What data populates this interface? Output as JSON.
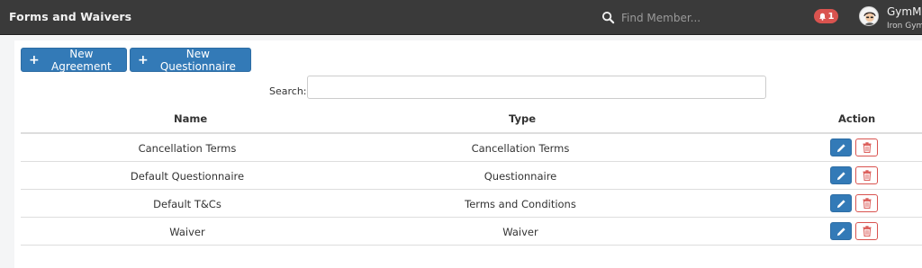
{
  "header": {
    "title": "Forms and Waivers",
    "search_placeholder": "Find Member...",
    "notification_count": "1",
    "user_name": "GymMas",
    "user_gym": "Iron Gym ..."
  },
  "toolbar": {
    "new_agreement_label": "New Agreement",
    "new_questionnaire_label": "New Questionnaire"
  },
  "table": {
    "search_label": "Search:",
    "columns": [
      "Name",
      "Type",
      "Action"
    ],
    "rows": [
      {
        "name": "Cancellation Terms",
        "type": "Cancellation Terms"
      },
      {
        "name": "Default Questionnaire",
        "type": "Questionnaire"
      },
      {
        "name": "Default T&Cs",
        "type": "Terms and Conditions"
      },
      {
        "name": "Waiver",
        "type": "Waiver"
      }
    ]
  },
  "colors": {
    "topbar": "#3a3a3a",
    "primary": "#337ab7",
    "danger": "#d9534f",
    "page_background": "#f4f5f6"
  },
  "icons": {
    "search": "search-icon",
    "bell": "bell-icon",
    "plus": "plus-icon",
    "edit": "pencil-icon",
    "delete": "trash-icon"
  }
}
